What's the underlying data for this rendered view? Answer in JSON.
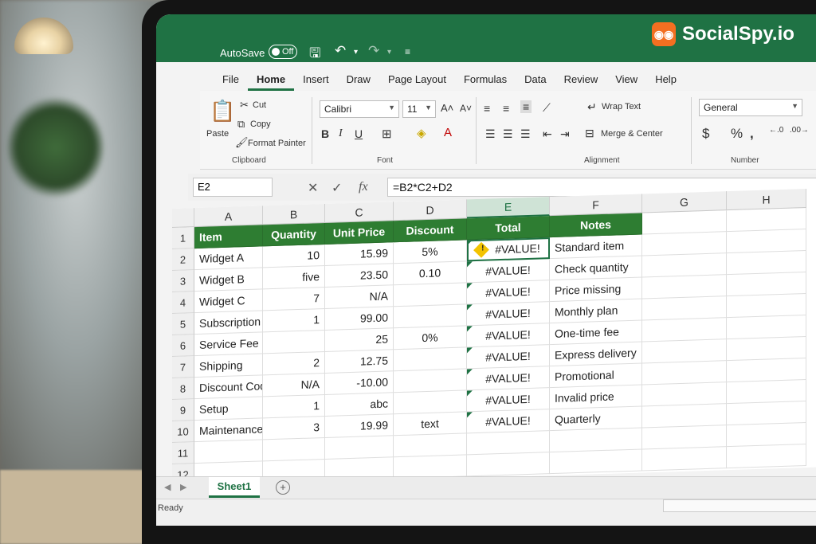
{
  "brand": {
    "name": "SocialSpy.io",
    "logo_glyph": "◉◉"
  },
  "titlebar": {
    "autosave_label": "AutoSave",
    "toggle_label": "Off"
  },
  "ribbon": {
    "tabs": [
      "File",
      "Home",
      "Insert",
      "Draw",
      "Page Layout",
      "Formulas",
      "Data",
      "Review",
      "View",
      "Help"
    ],
    "active_tab": "Home",
    "clipboard": {
      "paste": "Paste",
      "cut": "Cut",
      "copy": "Copy",
      "format_painter": "Format Painter",
      "label": "Clipboard"
    },
    "font": {
      "family": "Calibri",
      "size": "11",
      "label": "Font"
    },
    "alignment": {
      "wrap_text": "Wrap Text",
      "merge_center": "Merge & Center",
      "label": "Alignment"
    },
    "number": {
      "format": "General",
      "label": "Number"
    }
  },
  "formula_bar": {
    "name_box": "E2",
    "formula": "=B2*C2+D2"
  },
  "grid": {
    "columns": [
      "A",
      "B",
      "C",
      "D",
      "E",
      "F",
      "G",
      "H"
    ],
    "rows": [
      "1",
      "2",
      "3",
      "4",
      "5",
      "6",
      "7",
      "8",
      "9",
      "10",
      "11",
      "12"
    ],
    "headers": [
      "Item",
      "Quantity",
      "Unit Price",
      "Discount",
      "Total",
      "Notes"
    ],
    "data": [
      [
        "Widget A",
        "10",
        "15.99",
        "5%",
        "#VALUE!",
        "Standard item"
      ],
      [
        "Widget B",
        "five",
        "23.50",
        "0.10",
        "#VALUE!",
        "Check quantity"
      ],
      [
        "Widget C",
        "7",
        "N/A",
        "",
        "#VALUE!",
        "Price missing"
      ],
      [
        "Subscription",
        "1",
        "99.00",
        "",
        "#VALUE!",
        "Monthly plan"
      ],
      [
        "Service Fee",
        "",
        "25",
        "0%",
        "#VALUE!",
        "One-time fee"
      ],
      [
        "Shipping",
        "2",
        "12.75",
        "",
        "#VALUE!",
        "Express delivery"
      ],
      [
        "Discount Code",
        "N/A",
        "-10.00",
        "",
        "#VALUE!",
        "Promotional"
      ],
      [
        "Setup",
        "1",
        "abc",
        "",
        "#VALUE!",
        "Invalid price"
      ],
      [
        "Maintenance",
        "3",
        "19.99",
        "text",
        "#VALUE!",
        "Quarterly"
      ]
    ]
  },
  "sheets": {
    "active": "Sheet1"
  },
  "status": {
    "text": "Ready"
  }
}
